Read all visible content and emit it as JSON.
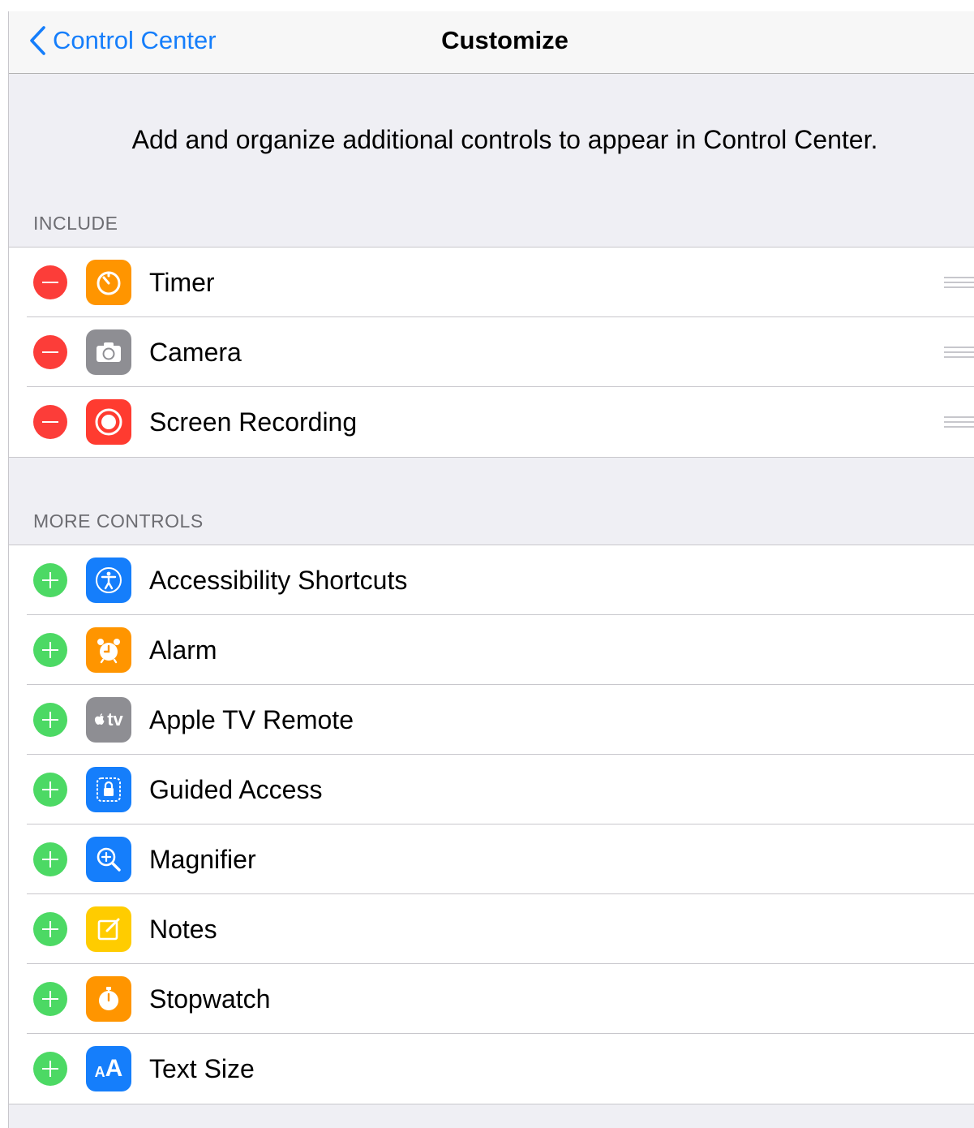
{
  "nav": {
    "back_label": "Control Center",
    "title": "Customize"
  },
  "description": "Add and organize additional controls to appear in Control Center.",
  "include": {
    "header": "INCLUDE",
    "items": [
      {
        "label": "Timer",
        "icon": "timer-icon",
        "color": "#ff9500"
      },
      {
        "label": "Camera",
        "icon": "camera-icon",
        "color": "#8e8e93"
      },
      {
        "label": "Screen Recording",
        "icon": "screen-recording-icon",
        "color": "#ff3b30"
      }
    ]
  },
  "more": {
    "header": "MORE CONTROLS",
    "items": [
      {
        "label": "Accessibility Shortcuts",
        "icon": "accessibility-icon",
        "color": "#157efb"
      },
      {
        "label": "Alarm",
        "icon": "alarm-icon",
        "color": "#ff9500"
      },
      {
        "label": "Apple TV Remote",
        "icon": "apple-tv-icon",
        "icon_text": "tv",
        "color": "#8e8e93"
      },
      {
        "label": "Guided Access",
        "icon": "guided-access-icon",
        "color": "#157efb"
      },
      {
        "label": "Magnifier",
        "icon": "magnifier-icon",
        "color": "#157efb"
      },
      {
        "label": "Notes",
        "icon": "notes-icon",
        "color": "#ffcc00"
      },
      {
        "label": "Stopwatch",
        "icon": "stopwatch-icon",
        "color": "#ff9500"
      },
      {
        "label": "Text Size",
        "icon": "text-size-icon",
        "icon_text_small": "A",
        "icon_text_large": "A",
        "color": "#157efb"
      }
    ]
  },
  "colors": {
    "tint": "#157efb",
    "remove": "#fc3d39",
    "add": "#4cd964",
    "background": "#efeff4"
  }
}
